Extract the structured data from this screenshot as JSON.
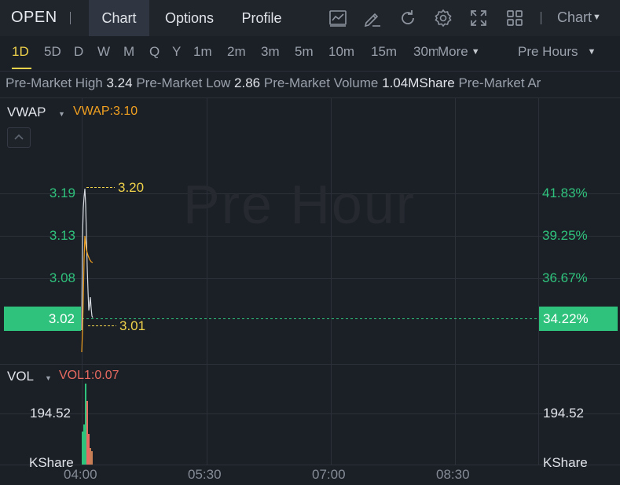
{
  "header": {
    "ticker": "OPEN",
    "tabs": [
      {
        "label": "Chart",
        "active": true
      },
      {
        "label": "Options",
        "active": false
      },
      {
        "label": "Profile",
        "active": false
      }
    ],
    "icons": [
      "chart-type-icon",
      "draw-icon",
      "refresh-icon",
      "settings-icon",
      "fullscreen-icon",
      "layout-icon"
    ],
    "chart_select": "Chart"
  },
  "periods": {
    "items": [
      "1D",
      "5D",
      "D",
      "W",
      "M",
      "Q",
      "Y",
      "1m",
      "2m",
      "3m",
      "5m",
      "10m",
      "15m",
      "30m"
    ],
    "active": "1D",
    "more_label": "More",
    "session_label": "Pre Hours"
  },
  "stats": {
    "high_label": "Pre-Market High",
    "high_value": "3.24",
    "low_label": "Pre-Market Low",
    "low_value": "2.86",
    "volume_label": "Pre-Market Volume",
    "volume_value": "1.04MShare",
    "more_label": "Pre-Market Ar"
  },
  "price_panel": {
    "indicator": "VWAP",
    "indicator_value": "VWAP:3.10",
    "watermark": "Pre Hour",
    "y_left": [
      "3.19",
      "3.13",
      "3.08"
    ],
    "y_right": [
      "41.83%",
      "39.25%",
      "36.67%"
    ],
    "current_price": "3.02",
    "current_pct": "34.22%",
    "high_marker": "3.20",
    "low_marker": "3.01"
  },
  "volume_panel": {
    "indicator": "VOL",
    "indicator_value": "VOL1:0.07",
    "y_value": "194.52",
    "unit": "KShare"
  },
  "x_axis": [
    "04:00",
    "05:30",
    "07:00",
    "08:30"
  ],
  "colors": {
    "up": "#2fc27c",
    "down": "#e86a60",
    "vwap": "#f0a020",
    "highlight": "#f0d34b",
    "background": "#1b1f26"
  }
}
